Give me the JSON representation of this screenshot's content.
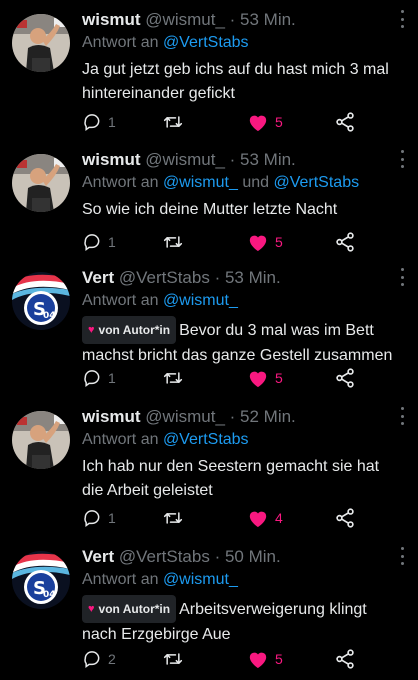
{
  "colors": {
    "accent": "#1d9bf0",
    "like": "#f91880",
    "muted": "#71767b",
    "text": "#e7e9ea",
    "background": "#000000"
  },
  "tweets": [
    {
      "author": "wismut",
      "handle": "@wismut_",
      "time": "· 53 Min.",
      "reply_prefix": "Antwort an",
      "reply_to": "@VertStabs",
      "reply_and": "",
      "reply_to2": "",
      "badge": "",
      "text": "Ja gut jetzt geb ichs auf du hast mich 3 mal hintereinander gefickt",
      "replies": "1",
      "likes": "5",
      "avatar_icon": "wismut-avatar-icon"
    },
    {
      "author": "wismut",
      "handle": "@wismut_",
      "time": "· 53 Min.",
      "reply_prefix": "Antwort an",
      "reply_to": "@wismut_",
      "reply_and": "und",
      "reply_to2": "@VertStabs",
      "badge": "",
      "text": "So wie ich deine Mutter letzte Nacht",
      "replies": "1",
      "likes": "5",
      "avatar_icon": "wismut-avatar-icon"
    },
    {
      "author": "Vert",
      "handle": "@VertStabs",
      "time": "· 53 Min.",
      "reply_prefix": "Antwort an",
      "reply_to": "@wismut_",
      "reply_and": "",
      "reply_to2": "",
      "badge": "von Autor*in",
      "text": "Bevor du 3 mal was im Bett machst bricht das ganze Gestell zusammen",
      "replies": "1",
      "likes": "5",
      "avatar_icon": "schalke-logo-icon"
    },
    {
      "author": "wismut",
      "handle": "@wismut_",
      "time": "· 52 Min.",
      "reply_prefix": "Antwort an",
      "reply_to": "@VertStabs",
      "reply_and": "",
      "reply_to2": "",
      "badge": "",
      "text": "Ich hab nur den Seestern gemacht sie hat die Arbeit geleistet",
      "replies": "1",
      "likes": "4",
      "avatar_icon": "wismut-avatar-icon"
    },
    {
      "author": "Vert",
      "handle": "@VertStabs",
      "time": "· 50 Min.",
      "reply_prefix": "Antwort an",
      "reply_to": "@wismut_",
      "reply_and": "",
      "reply_to2": "",
      "badge": "von Autor*in",
      "text": "Arbeitsverweigerung klingt nach Erzgebirge Aue",
      "replies": "2",
      "likes": "5",
      "avatar_icon": "schalke-logo-icon"
    }
  ]
}
